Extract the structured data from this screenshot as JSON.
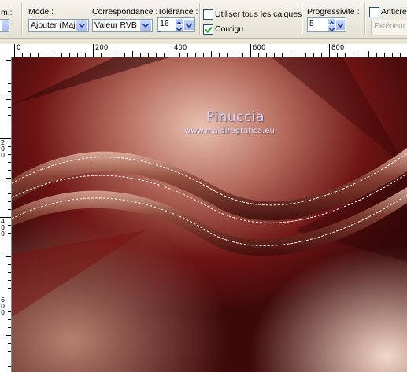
{
  "toolbar": {
    "partial_label": "m.:",
    "mode": {
      "label": "Mode :",
      "value": "Ajouter (Maj)"
    },
    "match": {
      "label": "Correspondance :",
      "value": "Valeur RVB"
    },
    "tolerance": {
      "label": "Tolérance :",
      "value": "16"
    },
    "all_layers": {
      "label": "Utiliser tous les calques",
      "checked": false
    },
    "contiguous": {
      "label": "Contigu",
      "checked": true
    },
    "progressivity": {
      "label": "Progressivité :",
      "value": "5"
    },
    "antialias": {
      "label": "Anticrén",
      "checked": false
    },
    "outside_button": "Extérieur"
  },
  "ruler": {
    "h_labels": [
      "0",
      "200",
      "400",
      "600",
      "800"
    ],
    "v_labels": [
      "2\n0\n0",
      "4\n0\n0",
      "6\n0\n0"
    ]
  },
  "canvas": {
    "watermark_title": "Pinuccia",
    "watermark_url": "www.maidiregrafica.eu"
  },
  "colors": {
    "selection": "#ffffff",
    "background_dark": "#5a0c0c",
    "wave": "#c08a6e"
  }
}
